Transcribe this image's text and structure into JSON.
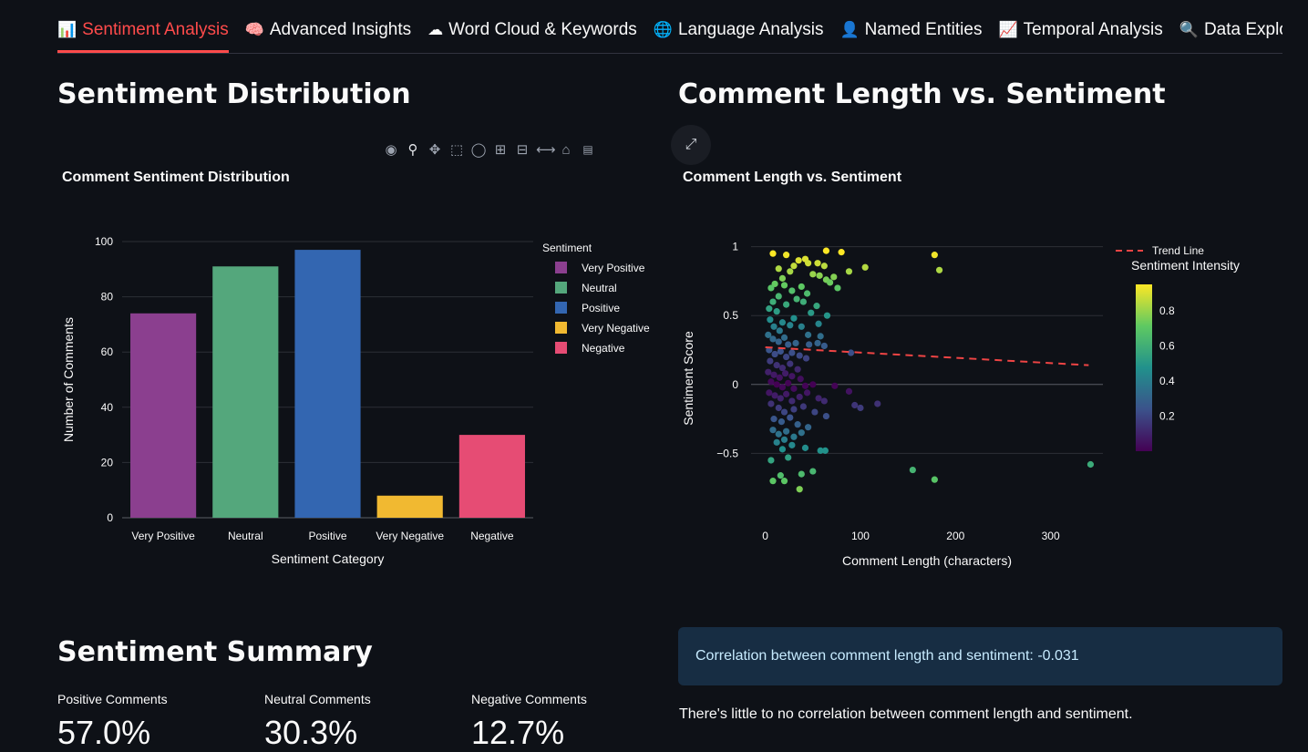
{
  "tabs": [
    {
      "icon": "📊",
      "label": "Sentiment Analysis",
      "active": true
    },
    {
      "icon": "🧠",
      "label": "Advanced Insights",
      "active": false
    },
    {
      "icon": "☁",
      "label": "Word Cloud & Keywords",
      "active": false
    },
    {
      "icon": "🌐",
      "label": "Language Analysis",
      "active": false
    },
    {
      "icon": "👤",
      "label": "Named Entities",
      "active": false
    },
    {
      "icon": "📈",
      "label": "Temporal Analysis",
      "active": false
    },
    {
      "icon": "🔍",
      "label": "Data Explorer",
      "active": false
    }
  ],
  "left": {
    "heading": "Sentiment Distribution",
    "chart_title": "Comment Sentiment Distribution"
  },
  "right": {
    "heading": "Comment Length vs. Sentiment",
    "chart_title": "Comment Length vs. Sentiment"
  },
  "summary": {
    "heading": "Sentiment Summary",
    "metrics": [
      {
        "label": "Positive Comments",
        "value": "57.0%"
      },
      {
        "label": "Neutral Comments",
        "value": "30.3%"
      },
      {
        "label": "Negative Comments",
        "value": "12.7%"
      }
    ]
  },
  "correlation_box": "Correlation between comment length and sentiment: -0.031",
  "correlation_note": "There's little to no correlation between comment length and sentiment.",
  "chart_data": [
    {
      "type": "bar",
      "title": "Comment Sentiment Distribution",
      "xlabel": "Sentiment Category",
      "ylabel": "Number of Comments",
      "categories": [
        "Very Positive",
        "Neutral",
        "Positive",
        "Very Negative",
        "Negative"
      ],
      "values": [
        74,
        91,
        97,
        8,
        30
      ],
      "colors": [
        "#8b3f8f",
        "#54a77c",
        "#3366b1",
        "#f1b931",
        "#e64c74"
      ],
      "ylim": [
        0,
        100
      ],
      "yticks": [
        0,
        20,
        40,
        60,
        80,
        100
      ],
      "legend_title": "Sentiment",
      "legend_position": "right",
      "legend": [
        "Very Positive",
        "Neutral",
        "Positive",
        "Very Negative",
        "Negative"
      ],
      "grid": true
    },
    {
      "type": "scatter",
      "title": "Comment Length vs. Sentiment",
      "xlabel": "Comment Length (characters)",
      "ylabel": "Sentiment Score",
      "xlim": [
        -15,
        355
      ],
      "ylim": [
        -0.98,
        1.07
      ],
      "xticks": [
        0,
        100,
        200,
        300
      ],
      "yticks": [
        -0.5,
        0,
        0.5,
        1
      ],
      "ytick_labels": [
        "−0.5",
        "0",
        "0.5",
        "1"
      ],
      "trend_line": {
        "name": "Trend Line",
        "x": [
          0,
          340
        ],
        "y": [
          0.27,
          0.14
        ],
        "color": "#ef4444"
      },
      "colorbar": {
        "title": "Sentiment Intensity",
        "ticks": [
          0.2,
          0.4,
          0.6,
          0.8
        ],
        "range": [
          0,
          0.95
        ],
        "scale": "viridis"
      },
      "grid": true,
      "points": [
        [
          8,
          0.95,
          0.95
        ],
        [
          22,
          0.94,
          0.93
        ],
        [
          35,
          0.9,
          0.9
        ],
        [
          42,
          0.91,
          0.9
        ],
        [
          55,
          0.88,
          0.88
        ],
        [
          64,
          0.97,
          0.95
        ],
        [
          80,
          0.96,
          0.95
        ],
        [
          178,
          0.94,
          0.93
        ],
        [
          183,
          0.83,
          0.83
        ],
        [
          105,
          0.85,
          0.84
        ],
        [
          88,
          0.82,
          0.82
        ],
        [
          62,
          0.86,
          0.85
        ],
        [
          30,
          0.86,
          0.86
        ],
        [
          14,
          0.84,
          0.83
        ],
        [
          26,
          0.82,
          0.82
        ],
        [
          45,
          0.88,
          0.88
        ],
        [
          50,
          0.8,
          0.8
        ],
        [
          57,
          0.79,
          0.78
        ],
        [
          64,
          0.76,
          0.75
        ],
        [
          72,
          0.78,
          0.77
        ],
        [
          76,
          0.7,
          0.7
        ],
        [
          68,
          0.74,
          0.73
        ],
        [
          18,
          0.77,
          0.76
        ],
        [
          10,
          0.73,
          0.72
        ],
        [
          6,
          0.7,
          0.69
        ],
        [
          20,
          0.72,
          0.72
        ],
        [
          28,
          0.68,
          0.67
        ],
        [
          38,
          0.71,
          0.71
        ],
        [
          44,
          0.66,
          0.65
        ],
        [
          33,
          0.62,
          0.62
        ],
        [
          14,
          0.64,
          0.63
        ],
        [
          8,
          0.6,
          0.59
        ],
        [
          4,
          0.55,
          0.54
        ],
        [
          12,
          0.53,
          0.52
        ],
        [
          22,
          0.58,
          0.57
        ],
        [
          40,
          0.6,
          0.59
        ],
        [
          54,
          0.57,
          0.56
        ],
        [
          48,
          0.52,
          0.51
        ],
        [
          65,
          0.5,
          0.49
        ],
        [
          30,
          0.48,
          0.47
        ],
        [
          18,
          0.45,
          0.44
        ],
        [
          5,
          0.47,
          0.46
        ],
        [
          9,
          0.42,
          0.41
        ],
        [
          15,
          0.39,
          0.38
        ],
        [
          26,
          0.43,
          0.42
        ],
        [
          38,
          0.42,
          0.41
        ],
        [
          56,
          0.44,
          0.43
        ],
        [
          45,
          0.36,
          0.35
        ],
        [
          58,
          0.35,
          0.34
        ],
        [
          3,
          0.36,
          0.35
        ],
        [
          8,
          0.33,
          0.32
        ],
        [
          14,
          0.31,
          0.3
        ],
        [
          20,
          0.34,
          0.33
        ],
        [
          24,
          0.29,
          0.28
        ],
        [
          32,
          0.3,
          0.3
        ],
        [
          46,
          0.29,
          0.28
        ],
        [
          55,
          0.3,
          0.3
        ],
        [
          62,
          0.28,
          0.27
        ],
        [
          4,
          0.25,
          0.25
        ],
        [
          10,
          0.22,
          0.22
        ],
        [
          16,
          0.24,
          0.24
        ],
        [
          22,
          0.2,
          0.2
        ],
        [
          28,
          0.23,
          0.23
        ],
        [
          36,
          0.21,
          0.21
        ],
        [
          43,
          0.19,
          0.19
        ],
        [
          90,
          0.23,
          0.23
        ],
        [
          5,
          0.17,
          0.17
        ],
        [
          12,
          0.14,
          0.14
        ],
        [
          18,
          0.12,
          0.12
        ],
        [
          26,
          0.15,
          0.15
        ],
        [
          34,
          0.11,
          0.11
        ],
        [
          3,
          0.09,
          0.09
        ],
        [
          9,
          0.07,
          0.07
        ],
        [
          15,
          0.05,
          0.05
        ],
        [
          21,
          0.08,
          0.08
        ],
        [
          28,
          0.06,
          0.06
        ],
        [
          37,
          0.04,
          0.04
        ],
        [
          6,
          0.02,
          0.02
        ],
        [
          12,
          0.0,
          0.0
        ],
        [
          18,
          -0.02,
          0.02
        ],
        [
          24,
          0.01,
          0.01
        ],
        [
          30,
          -0.03,
          0.03
        ],
        [
          42,
          -0.01,
          0.01
        ],
        [
          50,
          0.0,
          0.0
        ],
        [
          73,
          -0.01,
          0.01
        ],
        [
          88,
          -0.05,
          0.05
        ],
        [
          4,
          -0.06,
          0.06
        ],
        [
          10,
          -0.08,
          0.08
        ],
        [
          16,
          -0.1,
          0.1
        ],
        [
          22,
          -0.07,
          0.07
        ],
        [
          28,
          -0.12,
          0.12
        ],
        [
          36,
          -0.09,
          0.09
        ],
        [
          44,
          -0.06,
          0.06
        ],
        [
          56,
          -0.1,
          0.1
        ],
        [
          62,
          -0.12,
          0.12
        ],
        [
          94,
          -0.15,
          0.15
        ],
        [
          100,
          -0.17,
          0.17
        ],
        [
          118,
          -0.14,
          0.14
        ],
        [
          6,
          -0.14,
          0.14
        ],
        [
          14,
          -0.17,
          0.17
        ],
        [
          20,
          -0.2,
          0.2
        ],
        [
          30,
          -0.18,
          0.18
        ],
        [
          40,
          -0.16,
          0.16
        ],
        [
          52,
          -0.2,
          0.2
        ],
        [
          64,
          -0.23,
          0.23
        ],
        [
          9,
          -0.25,
          0.25
        ],
        [
          17,
          -0.27,
          0.27
        ],
        [
          26,
          -0.24,
          0.24
        ],
        [
          34,
          -0.29,
          0.29
        ],
        [
          45,
          -0.31,
          0.31
        ],
        [
          8,
          -0.33,
          0.33
        ],
        [
          14,
          -0.36,
          0.36
        ],
        [
          22,
          -0.34,
          0.34
        ],
        [
          30,
          -0.38,
          0.38
        ],
        [
          38,
          -0.35,
          0.35
        ],
        [
          12,
          -0.42,
          0.42
        ],
        [
          20,
          -0.4,
          0.4
        ],
        [
          28,
          -0.44,
          0.44
        ],
        [
          18,
          -0.47,
          0.47
        ],
        [
          42,
          -0.46,
          0.46
        ],
        [
          58,
          -0.48,
          0.48
        ],
        [
          63,
          -0.48,
          0.48
        ],
        [
          6,
          -0.55,
          0.55
        ],
        [
          24,
          -0.53,
          0.53
        ],
        [
          155,
          -0.62,
          0.62
        ],
        [
          178,
          -0.69,
          0.69
        ],
        [
          342,
          -0.58,
          0.58
        ],
        [
          38,
          -0.65,
          0.65
        ],
        [
          50,
          -0.63,
          0.63
        ],
        [
          16,
          -0.66,
          0.66
        ],
        [
          8,
          -0.7,
          0.7
        ],
        [
          20,
          -0.7,
          0.7
        ],
        [
          36,
          -0.76,
          0.76
        ]
      ]
    }
  ],
  "colors": {
    "background": "#0e1117",
    "accent": "#ff4b4b",
    "info_bg": "#172d43",
    "info_text": "#c7ebff"
  },
  "modebar_icons": [
    "camera-icon",
    "zoom-icon",
    "pan-icon",
    "box-select-icon",
    "lasso-icon",
    "zoom-in-icon",
    "zoom-out-icon",
    "autoscale-icon",
    "home-icon",
    "plotly-logo-icon"
  ]
}
